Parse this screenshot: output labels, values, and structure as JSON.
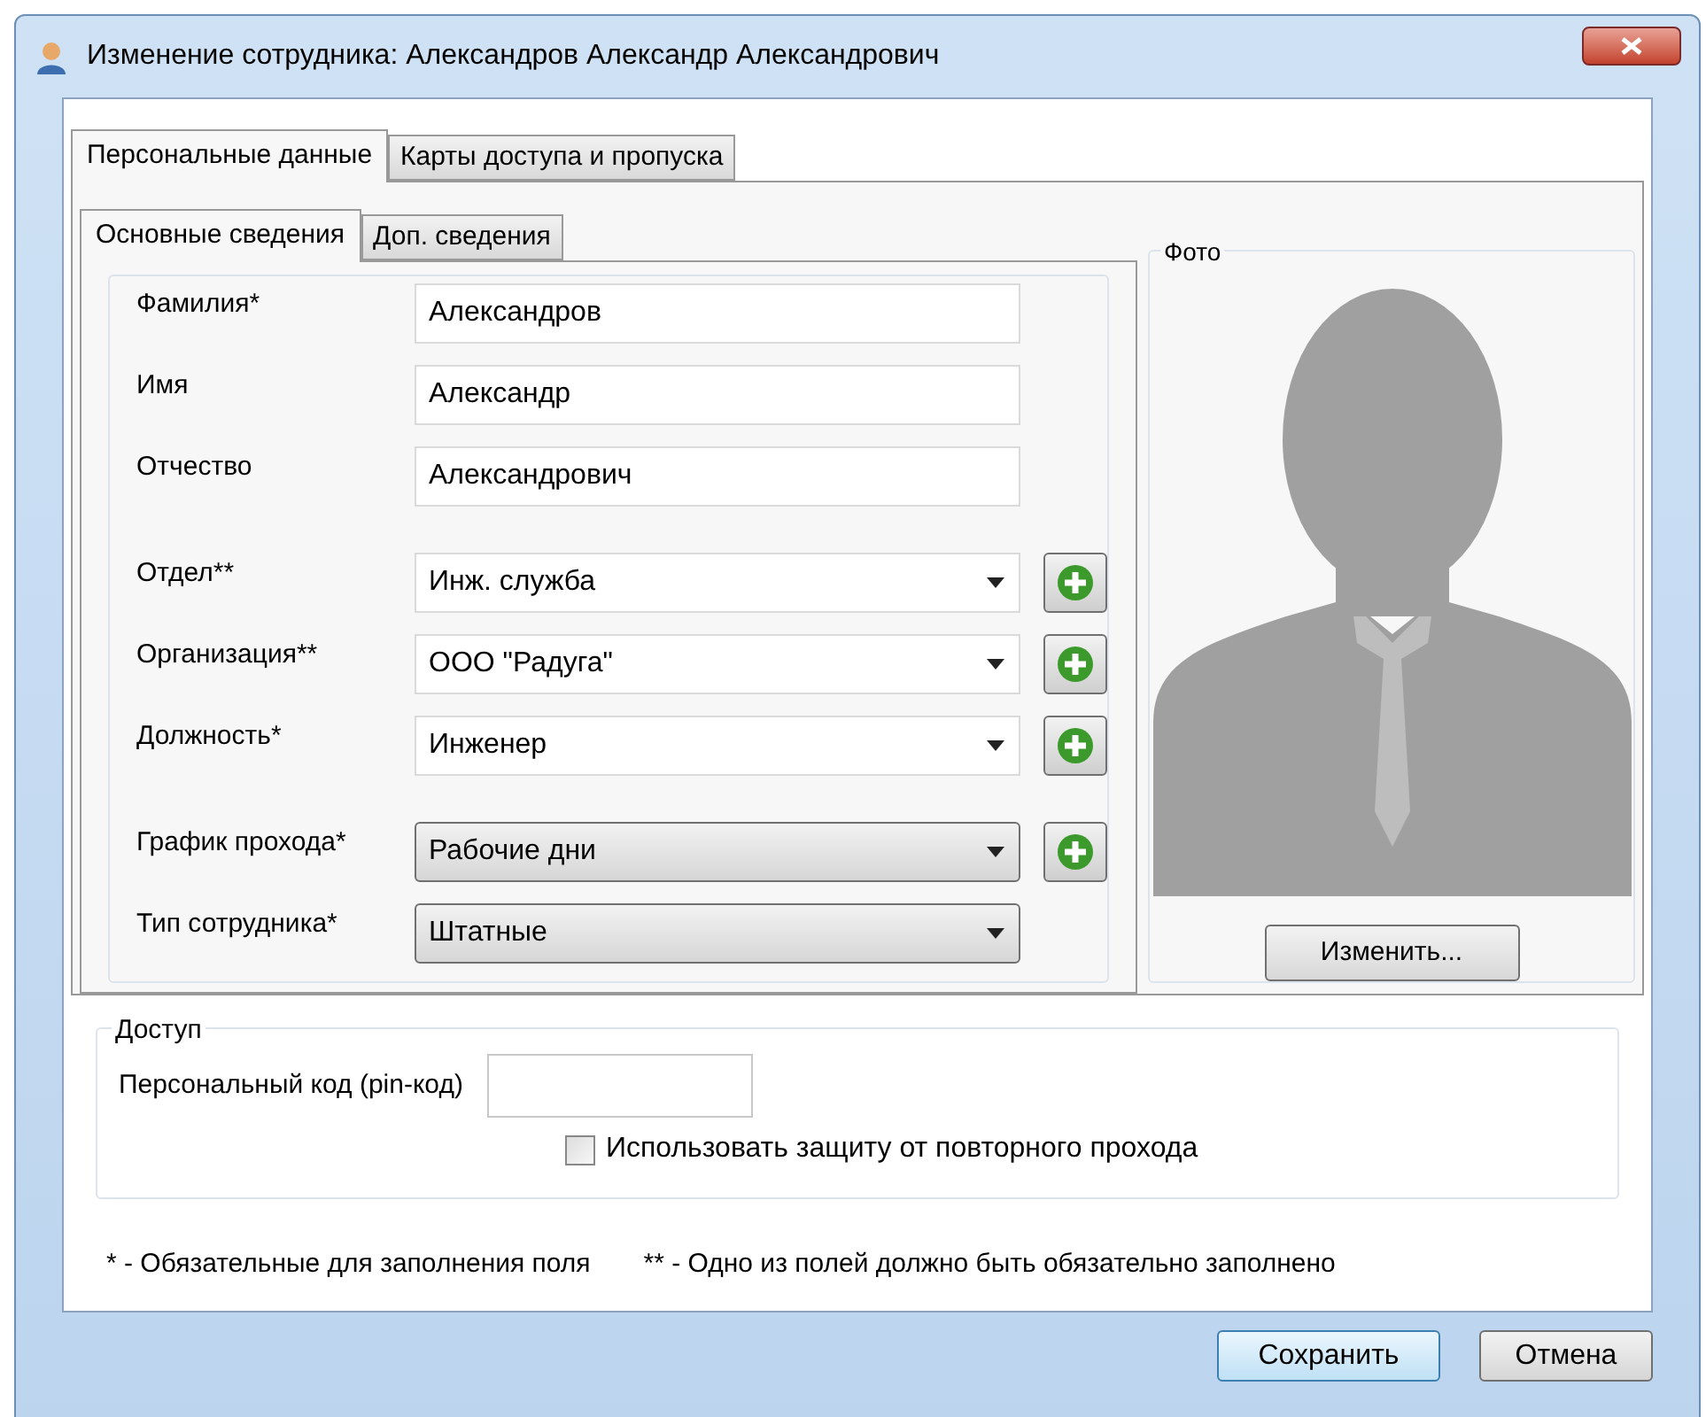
{
  "window": {
    "title": "Изменение сотрудника: Александров Александр Александрович"
  },
  "tabs": [
    {
      "label": "Персональные данные",
      "selected": true
    },
    {
      "label": "Карты доступа и пропуска",
      "selected": false
    }
  ],
  "subtabs": [
    {
      "label": "Основные сведения",
      "selected": true
    },
    {
      "label": "Доп. сведения",
      "selected": false
    }
  ],
  "field_groups": [
    [
      {
        "label": "Фамилия*",
        "kind": "text",
        "value": "Александров",
        "has_add": false
      },
      {
        "label": "Имя",
        "kind": "text",
        "value": "Александр",
        "has_add": false
      },
      {
        "label": "Отчество",
        "kind": "text",
        "value": "Александрович",
        "has_add": false
      }
    ],
    [
      {
        "label": "Отдел**",
        "kind": "combo",
        "value": "Инж. служба",
        "has_add": true
      },
      {
        "label": "Организация**",
        "kind": "combo",
        "value": "ООО \"Радуга\"",
        "has_add": true
      },
      {
        "label": "Должность*",
        "kind": "combo",
        "value": "Инженер",
        "has_add": true
      }
    ],
    [
      {
        "label": "График прохода*",
        "kind": "select",
        "value": "Рабочие дни",
        "has_add": true
      },
      {
        "label": "Тип сотрудника*",
        "kind": "select",
        "value": "Штатные",
        "has_add": false
      }
    ]
  ],
  "photo": {
    "legend": "Фото",
    "button": "Изменить..."
  },
  "access": {
    "legend": "Доступ",
    "pin_label": "Персональный код (pin-код)",
    "checkbox_label": "Использовать защиту от повторного прохода",
    "checked": false
  },
  "footnotes": [
    "* - Обязательные для заполнения поля",
    "** - Одно из полей должно быть обязательно заполнено"
  ],
  "buttons": [
    {
      "label": "Сохранить",
      "default": true
    },
    {
      "label": "Отмена",
      "default": false
    }
  ]
}
